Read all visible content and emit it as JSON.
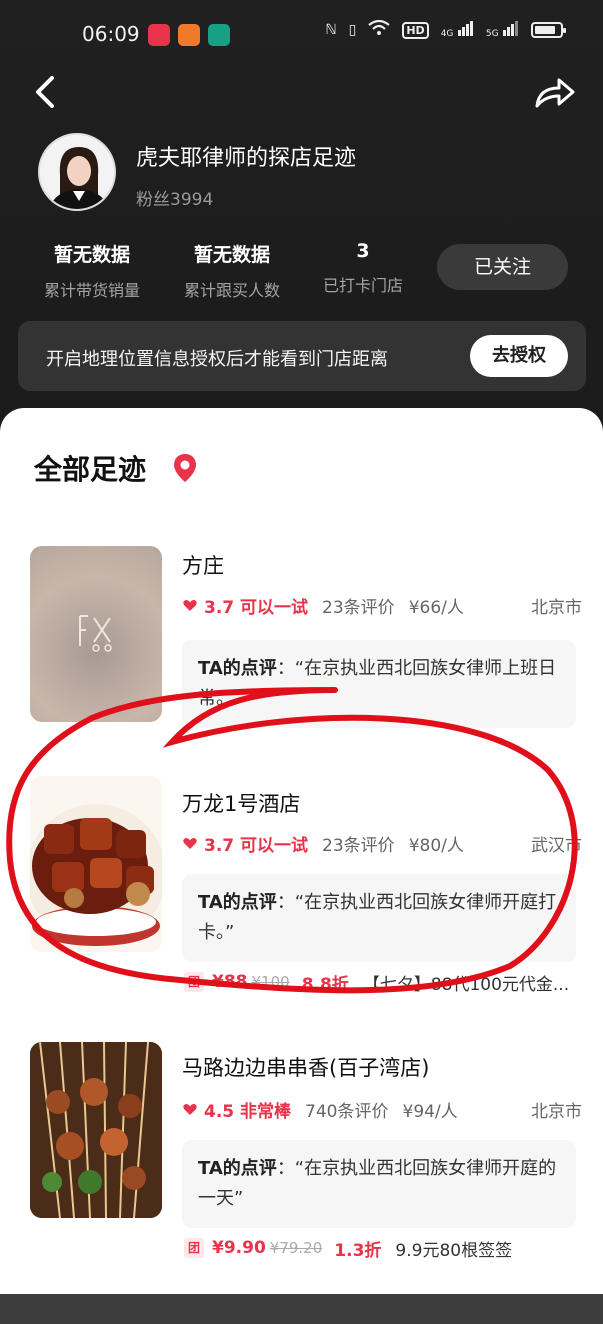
{
  "status_bar": {
    "time": "06:09",
    "app_icons": [
      "#e8334a",
      "#f07a2a",
      "#16a085"
    ],
    "hd_chip": "HD",
    "net_4g": "4G",
    "net_5g": "5G"
  },
  "header": {
    "back_icon": "chevron-left-icon",
    "share_icon": "share-arrow-icon"
  },
  "profile": {
    "title": "虎夫耶律师的探店足迹",
    "fans": "粉丝3994"
  },
  "stats": [
    {
      "value": "暂无数据",
      "label": "累计带货销量"
    },
    {
      "value": "暂无数据",
      "label": "累计跟买人数"
    },
    {
      "value": "3",
      "label": "已打卡门店"
    }
  ],
  "follow_button": "已关注",
  "location_banner": {
    "text": "开启地理位置信息授权后才能看到门店距离",
    "button": "去授权"
  },
  "section_title": "全部足迹",
  "colors": {
    "accent": "#e8334a",
    "dark_bg": "#1c1c1c",
    "annotation": "#e0101a"
  },
  "shops": [
    {
      "name": "方庄",
      "rating": "3.7 可以一试",
      "reviews": "23条评价",
      "price": "¥66/人",
      "city": "北京市",
      "review_label": "TA的点评",
      "review_text": "：“在京执业西北回族女律师上班日常。”"
    },
    {
      "name": "万龙1号酒店",
      "rating": "3.7 可以一试",
      "reviews": "23条评价",
      "price": "¥80/人",
      "city": "武汉市",
      "review_label": "TA的点评",
      "review_text": "：“在京执业西北回族女律师开庭打卡。”",
      "deal_tag": "团",
      "deal_price": "¥88",
      "deal_original": "¥100",
      "deal_discount": "8.8折",
      "deal_desc": "【七夕】88代100元代金..."
    },
    {
      "name": "马路边边串串香(百子湾店)",
      "rating": "4.5 非常棒",
      "reviews": "740条评价",
      "price": "¥94/人",
      "city": "北京市",
      "review_label": "TA的点评",
      "review_text": "：“在京执业西北回族女律师开庭的一天”",
      "deal_tag": "团",
      "deal_price": "¥9.90",
      "deal_original": "¥79.20",
      "deal_discount": "1.3折",
      "deal_desc": "9.9元80根签签"
    }
  ]
}
